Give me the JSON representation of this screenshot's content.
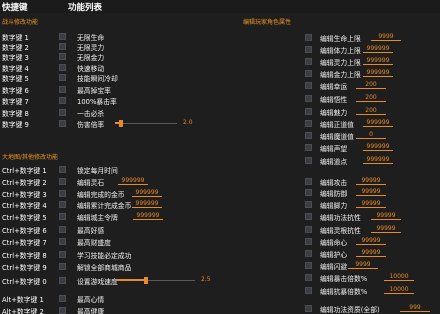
{
  "header": {
    "hotkeys_title": "快捷键",
    "features_title": "功能列表"
  },
  "sections": {
    "battle": "战斗修改功能",
    "player": "编辑玩家角色属性",
    "map": "大地图/其他修改功能"
  },
  "left_rows": [
    {
      "key": "数字键 1",
      "label": "无限生命"
    },
    {
      "key": "数字键 2",
      "label": "无限灵力"
    },
    {
      "key": "数字键 3",
      "label": "无限金力"
    },
    {
      "key": "数字键 4",
      "label": "快速移动"
    },
    {
      "key": "数字键 5",
      "label": "技能瞬间冷却"
    },
    {
      "key": "数字键 6",
      "label": "最高掉宝率"
    },
    {
      "key": "数字键 7",
      "label": "100%暴击率"
    },
    {
      "key": "数字键 8",
      "label": "一击必杀"
    },
    {
      "key": "数字键 9",
      "label": "伤害倍率",
      "slider": "2.0"
    }
  ],
  "map_rows": [
    {
      "key": "Ctrl+数字键 1",
      "label": "锁定每月时间"
    },
    {
      "key": "Ctrl+数字键 2",
      "label": "编辑灵石",
      "value": "999999"
    },
    {
      "key": "Ctrl+数字键 3",
      "label": "编辑完成的金币",
      "value": "999999"
    },
    {
      "key": "Ctrl+数字键 4",
      "label": "编辑累计完成金币",
      "value": "999999"
    },
    {
      "key": "Ctrl+数字键 5",
      "label": "编辑城主令牌",
      "value": "999999"
    },
    {
      "key": "Ctrl+数字键 6",
      "label": "最高好感"
    },
    {
      "key": "Ctrl+数字键 7",
      "label": "最高财盛度"
    },
    {
      "key": "Ctrl+数字键 8",
      "label": "学习技能必定成功"
    },
    {
      "key": "Ctrl+数字键 9",
      "label": "解锁全部商城商品"
    },
    {
      "key": "Ctrl+数字键 0",
      "label": "设置游戏速度",
      "slider": "2.5"
    }
  ],
  "alt_rows": [
    {
      "key": "Alt+数字键 1",
      "label": "最高心情"
    },
    {
      "key": "Alt+数字键 2",
      "label": "最高健康"
    }
  ],
  "right_rows": [
    {
      "label": "编辑生命上限",
      "value": "9999"
    },
    {
      "label": "编辑体力上限",
      "value": "999999"
    },
    {
      "label": "编辑灵力上限",
      "value": "999999"
    },
    {
      "label": "编辑金力上限",
      "value": "999999"
    },
    {
      "label": "编辑幸运",
      "value": "200"
    },
    {
      "label": "编辑悟性",
      "value": "200"
    },
    {
      "label": "编辑魅力",
      "value": "200"
    },
    {
      "label": "编辑正道值",
      "value": "999999"
    },
    {
      "label": "编辑魔道值",
      "value": "0"
    },
    {
      "label": "编辑声望",
      "value": "999999"
    },
    {
      "label": "编辑道点",
      "value": "999999"
    },
    {
      "label": "编辑攻击",
      "value": "99999"
    },
    {
      "label": "编辑防御",
      "value": "99999"
    },
    {
      "label": "编辑脚力",
      "value": "99999"
    },
    {
      "label": "编辑功法抗性",
      "value": "99999"
    },
    {
      "label": "编辑灵根抗性",
      "value": "99999"
    },
    {
      "label": "编辑命心",
      "value": "99999"
    },
    {
      "label": "编辑护心",
      "value": "99999"
    },
    {
      "label": "编辑闪避",
      "value": "9999"
    },
    {
      "label": "编辑暴击倍数%",
      "value": "10000"
    },
    {
      "label": "编辑抗暴倍数%",
      "value": "10000"
    },
    {
      "label": "编辑功法资质(全部)",
      "value": "999"
    }
  ]
}
